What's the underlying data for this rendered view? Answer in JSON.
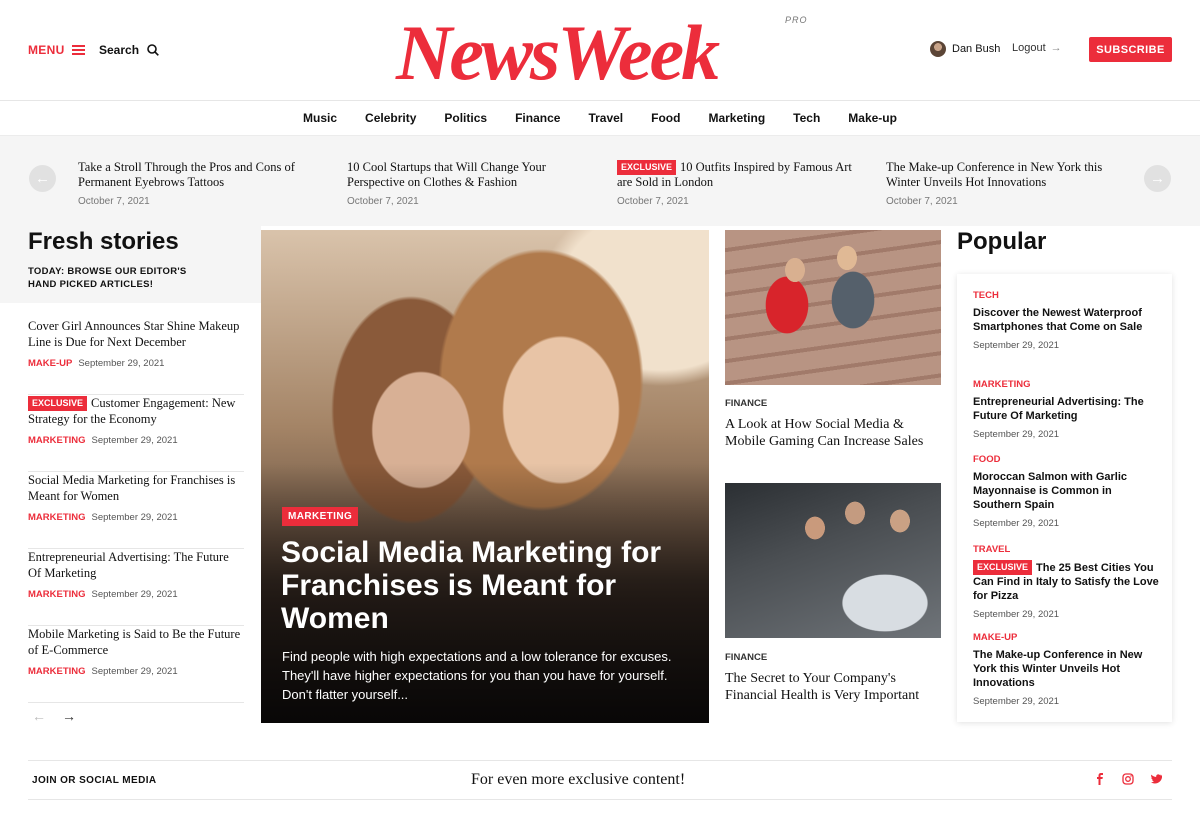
{
  "header": {
    "menu_label": "MENU",
    "search_label": "Search",
    "logo": "NewsWeek",
    "logo_badge": "PRO",
    "user_name": "Dan Bush",
    "logout_label": "Logout",
    "subscribe_label": "SUBSCRIBE"
  },
  "nav": [
    "Music",
    "Celebrity",
    "Politics",
    "Finance",
    "Travel",
    "Food",
    "Marketing",
    "Tech",
    "Make-up"
  ],
  "ticker": [
    {
      "title": "Take a Stroll Through the Pros and Cons of Permanent Eyebrows Tattoos",
      "date": "October 7, 2021",
      "badge": ""
    },
    {
      "title": "10 Cool Startups that Will Change Your Perspective on Clothes & Fashion",
      "date": "October 7, 2021",
      "badge": ""
    },
    {
      "title": "10 Outfits Inspired by Famous Art are Sold in London",
      "date": "October 7, 2021",
      "badge": "EXCLUSIVE"
    },
    {
      "title": "The Make-up Conference in New York this Winter Unveils Hot Innovations",
      "date": "October 7, 2021",
      "badge": ""
    }
  ],
  "fresh": {
    "title": "Fresh stories",
    "subtitle_line1": "TODAY: BROWSE OUR EDITOR'S",
    "subtitle_line2": "HAND PICKED ARTICLES!",
    "items": [
      {
        "title": "Cover Girl Announces Star Shine Makeup Line is Due for Next December",
        "category": "MAKE-UP",
        "date": "September 29, 2021",
        "badge": ""
      },
      {
        "title": "Customer Engagement: New Strategy for the Economy",
        "category": "MARKETING",
        "date": "September 29, 2021",
        "badge": "EXCLUSIVE"
      },
      {
        "title": "Social Media Marketing for Franchises is Meant for Women",
        "category": "MARKETING",
        "date": "September 29, 2021",
        "badge": ""
      },
      {
        "title": "Entrepreneurial Advertising: The Future Of Marketing",
        "category": "MARKETING",
        "date": "September 29, 2021",
        "badge": ""
      },
      {
        "title": "Mobile Marketing is Said to Be the Future of E-Commerce",
        "category": "MARKETING",
        "date": "September 29, 2021",
        "badge": ""
      }
    ]
  },
  "hero": {
    "category": "MARKETING",
    "title": "Social Media Marketing for Franchises is Meant for Women",
    "description": "Find people with high expectations and a low tolerance for excuses. They'll have higher expectations for you than you have for yourself. Don't flatter yourself..."
  },
  "cards": [
    {
      "category": "FINANCE",
      "title": "A Look at How Social Media & Mobile Gaming Can Increase Sales"
    },
    {
      "category": "FINANCE",
      "title": "The Secret to Your Company's Financial Health is Very Important"
    }
  ],
  "popular": {
    "title": "Popular",
    "items": [
      {
        "category": "TECH",
        "title": "Discover the Newest Waterproof Smartphones that Come on Sale",
        "date": "September 29, 2021",
        "badge": ""
      },
      {
        "category": "MARKETING",
        "title": "Entrepreneurial Advertising: The Future Of Marketing",
        "date": "September 29, 2021",
        "badge": ""
      },
      {
        "category": "FOOD",
        "title": "Moroccan Salmon with Garlic Mayonnaise is Common in Southern Spain",
        "date": "September 29, 2021",
        "badge": ""
      },
      {
        "category": "TRAVEL",
        "title": "The 25 Best Cities You Can Find in Italy to Satisfy the Love for Pizza",
        "date": "September 29, 2021",
        "badge": "EXCLUSIVE"
      },
      {
        "category": "MAKE-UP",
        "title": "The Make-up Conference in New York this Winter Unveils Hot Innovations",
        "date": "September 29, 2021",
        "badge": ""
      }
    ]
  },
  "footer": {
    "left": "JOIN OR SOCIAL MEDIA",
    "center": "For even more exclusive content!"
  },
  "colors": {
    "accent": "#ec2d3b"
  },
  "icons": [
    "menu-icon",
    "search-icon",
    "logout-arrow-icon",
    "arrow-left-icon",
    "arrow-right-icon",
    "facebook-icon",
    "instagram-icon",
    "twitter-icon"
  ]
}
